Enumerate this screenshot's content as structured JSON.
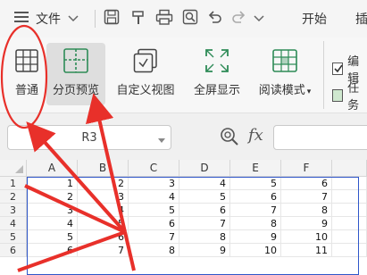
{
  "menu": {
    "label": "文件",
    "start_tab": "开始",
    "next_tab_partial": "插"
  },
  "ribbon": {
    "normal": "普通",
    "page_break_preview": "分页预览",
    "custom_view": "自定义视图",
    "full_screen": "全屏显示",
    "reading_mode": "阅读模式",
    "checkbox_1_partial": "编辑",
    "checkbox_2_partial": "任务"
  },
  "formula_bar": {
    "name_box": "R3",
    "fx": "fx"
  },
  "sheet": {
    "columns": [
      "A",
      "B",
      "C",
      "D",
      "E",
      "F"
    ],
    "rows": [
      {
        "num": "1",
        "cells": [
          "1",
          "2",
          "3",
          "4",
          "5",
          "6"
        ]
      },
      {
        "num": "2",
        "cells": [
          "2",
          "3",
          "4",
          "5",
          "6",
          "7"
        ]
      },
      {
        "num": "3",
        "cells": [
          "3",
          "4",
          "5",
          "6",
          "7",
          "8"
        ]
      },
      {
        "num": "4",
        "cells": [
          "4",
          "5",
          "6",
          "7",
          "8",
          "9"
        ]
      },
      {
        "num": "5",
        "cells": [
          "5",
          "6",
          "7",
          "8",
          "9",
          "10"
        ]
      },
      {
        "num": "6",
        "cells": [
          "6",
          "7",
          "8",
          "9",
          "10",
          "11"
        ]
      }
    ]
  },
  "colors": {
    "annotation": "#e8302a",
    "selection": "#2f56c9",
    "active_tab": "#dedede"
  }
}
